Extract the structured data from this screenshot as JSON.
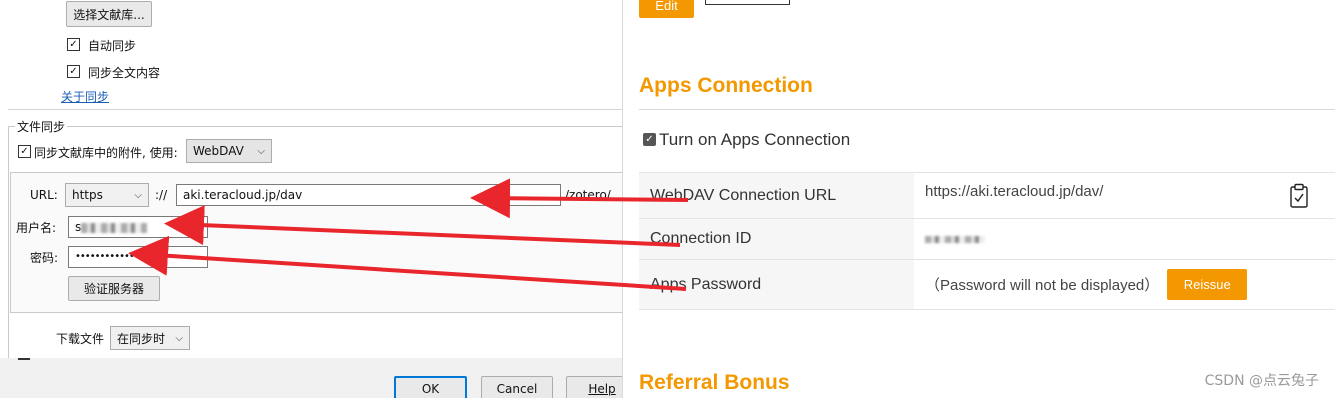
{
  "zotero": {
    "choose_library_button": "选择文献库...",
    "auto_sync_label": "自动同步",
    "sync_fulltext_label": "同步全文内容",
    "about_sync_link": "关于同步",
    "file_sync_group_title": "文件同步",
    "sync_attachments_label": "同步文献库中的附件, 使用:",
    "sync_method": "WebDAV",
    "url_label": "URL:",
    "protocol": "https",
    "protocol_sep": "://",
    "url_value": "aki.teracloud.jp/dav",
    "url_suffix": "/zotero/",
    "username_label": "用户名:",
    "username_value": "s",
    "password_label": "密码:",
    "password_value": "••••••••••••••••",
    "verify_button": "验证服务器",
    "download_files_label": "下载文件",
    "download_mode": "在同步时",
    "ok_button": "OK",
    "cancel_button": "Cancel",
    "help_button": "Help"
  },
  "teracloud": {
    "edit_button": "Edit",
    "apps_connection_heading": "Apps Connection",
    "turn_on_label": "Turn on Apps Connection",
    "rows": [
      {
        "label": "WebDAV Connection URL",
        "value": "https://aki.teracloud.jp/dav/"
      },
      {
        "label": "Connection ID",
        "value": ""
      },
      {
        "label": "Apps Password",
        "value": "（Password will not be displayed）"
      }
    ],
    "reissue_button": "Reissue",
    "referral_heading": "Referral Bonus"
  },
  "watermark": "CSDN @点云兔子",
  "colors": {
    "accent": "#f39800",
    "arrow": "#e8262c",
    "link": "#1a5fb4"
  },
  "icons": [
    "checkbox-checked-icon",
    "chevron-down-icon",
    "clipboard-copy-icon",
    "arrow-icon"
  ]
}
